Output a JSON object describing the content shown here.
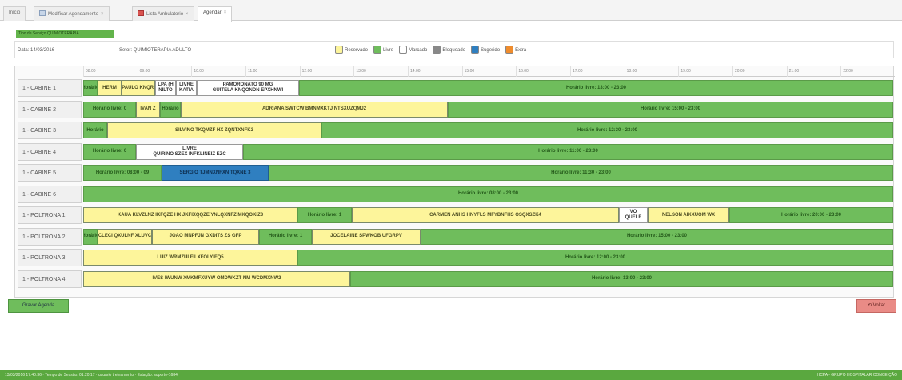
{
  "tabs": [
    {
      "label": "Início",
      "icon": "",
      "active": false
    },
    {
      "label": "Modificar Agendamento",
      "icon": "document-icon",
      "active": false
    },
    {
      "label": "Lista Ambulatorio",
      "icon": "list-icon",
      "active": false
    },
    {
      "label": "Agendar",
      "icon": "",
      "active": true
    }
  ],
  "chip_label": "Tipo de Serviço QUIMIOTERÁPIA",
  "info": {
    "date": "Data: 14/03/2016",
    "setor": "Setor: QUIMIOTERAPIA ADULTO"
  },
  "legend": [
    {
      "label": "Reservado",
      "color": "#fdf59b"
    },
    {
      "label": "Livre",
      "color": "#6fbd5c"
    },
    {
      "label": "Marcado",
      "color": "#ffffff"
    },
    {
      "label": "Bloqueado",
      "color": "#888888"
    },
    {
      "label": "Sugerido",
      "color": "#2f7fc0"
    },
    {
      "label": "Extra",
      "color": "#f08c2c"
    }
  ],
  "timeline": [
    "08:00",
    "09:00",
    "10:00",
    "11:00",
    "12:00",
    "13:00",
    "14:00",
    "15:00",
    "16:00",
    "17:00",
    "18:00",
    "19:00",
    "20:00",
    "21:00",
    "22:00"
  ],
  "rows": [
    {
      "label": "1 - CABINE 1",
      "slots": [
        {
          "type": "livre",
          "text": "Horário"
        },
        {
          "type": "res",
          "text": "HERM"
        },
        {
          "type": "res",
          "text": "PAULO KNQRI"
        },
        {
          "type": "wh",
          "text": "LPA (H\nNILTO"
        },
        {
          "type": "wh",
          "text": "LIVRE\nKATIA"
        },
        {
          "type": "wh",
          "text": "PAMORONATO 90 MG\nGUITELA KNQONDN EPXHNWI"
        },
        {
          "type": "livre",
          "text": "Horário livre: 13:00 - 23:00"
        }
      ]
    },
    {
      "label": "1 - CABINE 2",
      "slots": [
        {
          "type": "livre",
          "text": "Horário livre: 0"
        },
        {
          "type": "res",
          "text": "IVAN Z"
        },
        {
          "type": "livre",
          "text": "Horário"
        },
        {
          "type": "res",
          "text": "ADRIANA SWTCW BMNMXKTJ NTSXUZQMJ2"
        },
        {
          "type": "livre",
          "text": "Horário livre: 15:00 - 23:00"
        }
      ]
    },
    {
      "label": "1 - CABINE 3",
      "slots": [
        {
          "type": "livre",
          "text": "Horário"
        },
        {
          "type": "res",
          "text": "SILVINO TKQMZF HX ZQNTXNFK3"
        },
        {
          "type": "livre",
          "text": "Horário livre: 12:30 - 23:00"
        }
      ]
    },
    {
      "label": "1 - CABINE 4",
      "slots": [
        {
          "type": "livre",
          "text": "Horário livre: 0"
        },
        {
          "type": "wh",
          "text": "LIVRE\nQUIRINO SZEX INFKLINEIZ EZC"
        },
        {
          "type": "livre",
          "text": "Horário livre: 11:00 - 23:00"
        }
      ]
    },
    {
      "label": "1 - CABINE 5",
      "slots": [
        {
          "type": "livre",
          "text": "Horário livre: 08:00 - 09"
        },
        {
          "type": "sug",
          "text": "SERGIO TJMNXNFXN TQXNE 3"
        },
        {
          "type": "livre",
          "text": "Horário livre: 11:30 - 23:00"
        }
      ]
    },
    {
      "label": "1 - CABINE 6",
      "slots": [
        {
          "type": "livre",
          "text": "Horário livre: 08:00 - 23:00"
        }
      ]
    },
    {
      "label": "1 - POLTRONA 1",
      "slots": [
        {
          "type": "res",
          "text": "KAUA KLVZLNZ IKFQZE HX JKFIXQQZE YNLQXNFZ MKQOKIZ3"
        },
        {
          "type": "livre",
          "text": "Horário livre: 1"
        },
        {
          "type": "res",
          "text": "CARMEN ANHS HNYFLS MFYBNFHS OSQXSZK4"
        },
        {
          "type": "wh",
          "text": "VO\nQUELE"
        },
        {
          "type": "res",
          "text": "NELSON AIKXUOM WX"
        },
        {
          "type": "livre",
          "text": "Horário livre: 20:00 - 23:00"
        }
      ]
    },
    {
      "label": "1 - POLTRONA 2",
      "slots": [
        {
          "type": "livre",
          "text": "Horário"
        },
        {
          "type": "res",
          "text": "CLECI QXULNF XLUVC"
        },
        {
          "type": "res",
          "text": "JOAO MNPFJN GXDITS ZS GFP"
        },
        {
          "type": "livre",
          "text": "Horário livre: 1"
        },
        {
          "type": "res",
          "text": "JOCELAINE SPWKOB UFGRPV"
        },
        {
          "type": "livre",
          "text": "Horário livre: 15:00 - 23:00"
        }
      ]
    },
    {
      "label": "1 - POLTRONA 3",
      "slots": [
        {
          "type": "res",
          "text": "LUIZ WRMZUI FILXFOI YIFQ5"
        },
        {
          "type": "livre",
          "text": "Horário livre: 12:00 - 23:00"
        }
      ]
    },
    {
      "label": "1 - POLTRONA 4",
      "slots": [
        {
          "type": "res",
          "text": "IVES IWUNW XMKMFXUYW OMDWKZT NM WCDMXNW2"
        },
        {
          "type": "livre",
          "text": "Horário livre: 13:00 - 23:00"
        }
      ]
    }
  ],
  "buttons": {
    "gravar": "Gravar Agenda",
    "voltar": "Voltar"
  },
  "status": {
    "left": "13/03/2016 17:40:36 · Tempo de Sessão: 01:20:17 · usuário treinamento · Estação: suporte-1684",
    "right": "HCPA - GRUPO HOSPITALAR CONCEIÇÃO"
  }
}
